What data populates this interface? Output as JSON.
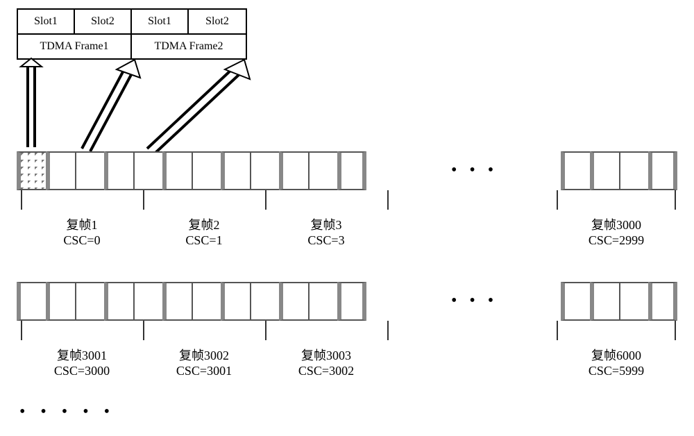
{
  "tdma": {
    "slot1": "Slot1",
    "slot2": "Slot2",
    "frame1": "TDMA Frame1",
    "frame2": "TDMA Frame2"
  },
  "mf_prefix": "复帧",
  "csc_prefix": "CSC=",
  "row1": {
    "labels": [
      {
        "name": "1",
        "csc": "0"
      },
      {
        "name": "2",
        "csc": "1"
      },
      {
        "name": "3",
        "csc": "3"
      },
      {
        "name": "3000",
        "csc": "2999"
      }
    ]
  },
  "row2": {
    "labels": [
      {
        "name": "3001",
        "csc": "3000"
      },
      {
        "name": "3002",
        "csc": "3001"
      },
      {
        "name": "3003",
        "csc": "3002"
      },
      {
        "name": "6000",
        "csc": "5999"
      }
    ]
  },
  "dots": "• • •",
  "trail": "• • • • •"
}
